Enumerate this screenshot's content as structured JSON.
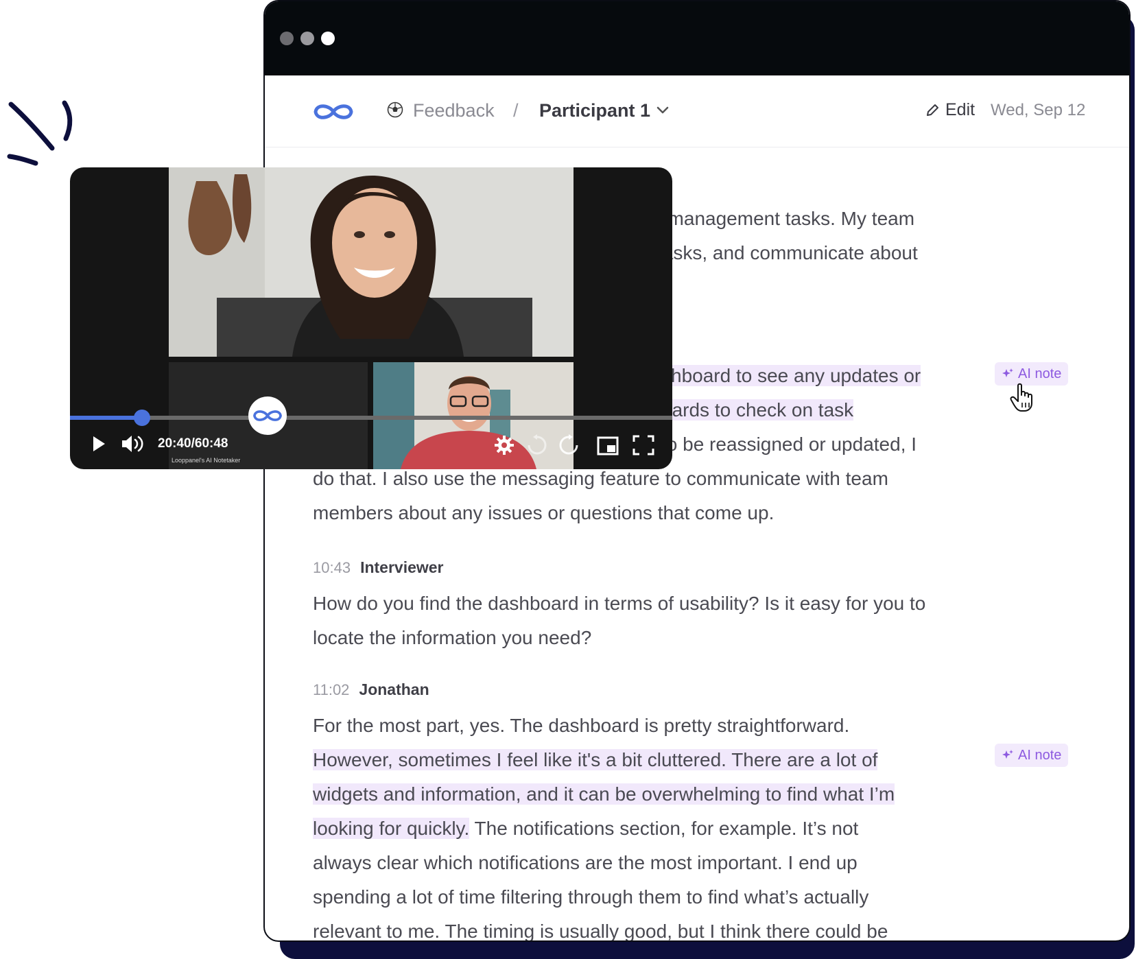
{
  "header": {
    "breadcrumb_parent": "Feedback",
    "breadcrumb_separator": "/",
    "breadcrumb_current": "Participant 1",
    "edit_label": "Edit",
    "date": "Wed, Sep 12"
  },
  "transcript": {
    "block1_lines": [
      "t management tasks. My team",
      "tasks, and communicate about"
    ],
    "block2_hl_line1": "shboard to see any updates or",
    "block2_hl_line2": "oards to check on task",
    "block2_line3": "to be reassigned or updated, I",
    "block2_line4": "do that. I also use the messaging feature to communicate with team",
    "block2_line5": "members about any issues or questions that come up.",
    "entries": [
      {
        "time": "10:43",
        "speaker": "Interviewer",
        "lines": [
          "How do you find the dashboard in terms of usability? Is it easy for you to",
          "locate the information you need?"
        ]
      },
      {
        "time": "11:02",
        "speaker": "Jonathan",
        "line1": "For the most part, yes. The dashboard is pretty straightforward.",
        "hl_line2": "However, sometimes I feel like it's a bit cluttered. There are a lot of",
        "hl_line3": "widgets and information, and it can be overwhelming to find what I’m",
        "hl_line4_part": "looking for quickly.",
        "line4_rest": " The notifications section, for example. It’s not",
        "line5": "always clear which notifications are the most important. I end up",
        "line6": "spending a lot of time filtering through them to find what’s actually",
        "line7": "relevant to me. The timing is usually good, but I think there could be"
      }
    ]
  },
  "ai_notes": [
    "AI note",
    "AI note"
  ],
  "video": {
    "time": "20:40/60:48",
    "caption": "Looppanel's AI Notetaker",
    "progress": 0.12
  },
  "icons": [
    "infinity-logo-icon",
    "soccer-ball-icon",
    "chevron-down-icon",
    "pencil-icon",
    "sparkle-icon",
    "hand-cursor-icon",
    "play-icon",
    "volume-icon",
    "gear-icon",
    "rewind-10-icon",
    "forward-10-icon",
    "picture-in-picture-icon",
    "fullscreen-icon"
  ],
  "colors": {
    "brand_blue": "#4a72dd",
    "ai_purple": "#8d5ae0",
    "highlight": "#f1e8fb",
    "dark_navy": "#0d0f3c"
  }
}
